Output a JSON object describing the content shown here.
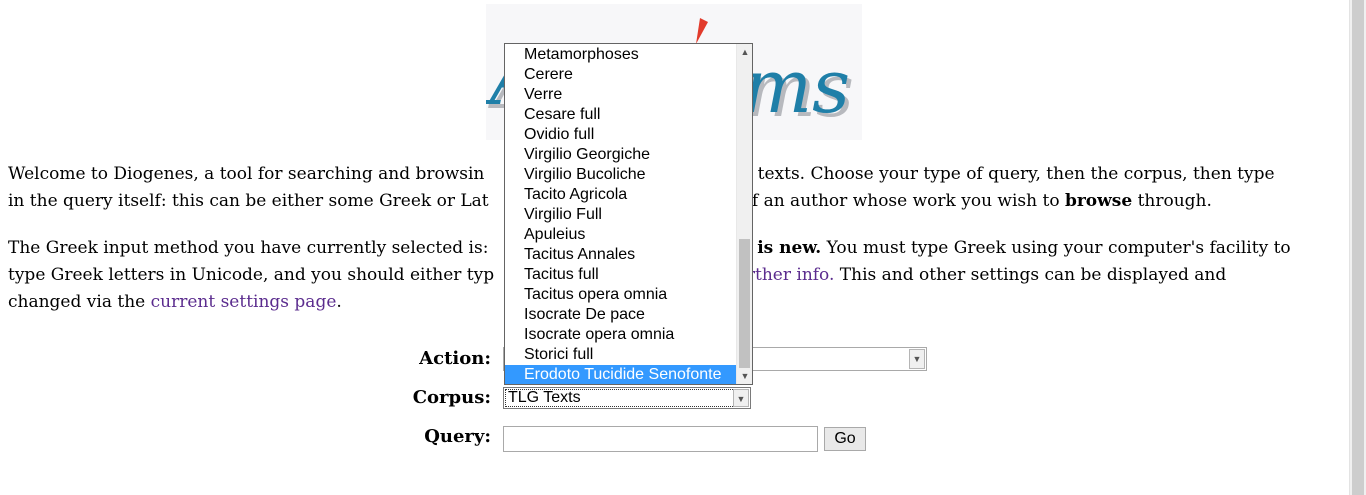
{
  "logo": {
    "alt_text": "Diogenes",
    "colors": {
      "primary": "#1f7fa8",
      "accent": "#e23b2c",
      "shadow": "#6b6f78"
    }
  },
  "intro": {
    "p1": {
      "a": "Welcome to Diogenes, a tool for searching and browsin",
      "b": "ent texts. Choose your type of query, then the corpus, then type",
      "c": "in the query itself: this can be either some Greek or Lat",
      "d": "of an author whose work you wish to ",
      "browse": "browse",
      "e": " through."
    },
    "p2": {
      "a": "The Greek input method you have currently selected is:",
      "bold": "t is new.",
      "b": " You must type Greek using your computer's facility to",
      "c": "type Greek letters in Unicode, and you should either typ",
      "further_info": "Further info.",
      "d": " This and other settings can be displayed and",
      "e": "changed via the ",
      "settings_link": "current settings page",
      "f": "."
    }
  },
  "form": {
    "action_label": "Action:",
    "corpus_label": "Corpus:",
    "query_label": "Query:",
    "corpus_value": "TLG Texts",
    "query_value": "",
    "go_label": "Go"
  },
  "dropdown": {
    "items": [
      "Metamorphoses",
      "Cerere",
      "Verre",
      "Cesare full",
      "Ovidio full",
      "Virgilio Georgiche",
      "Virgilio Bucoliche",
      "Tacito Agricola",
      "Virgilio Full",
      "Apuleius",
      "Tacitus Annales",
      "Tacitus full",
      "Tacitus opera omnia",
      "Isocrate De pace",
      "Isocrate opera omnia",
      "Storici full",
      "Erodoto Tucidide Senofonte"
    ],
    "selected_index": 16,
    "scroll_fraction": 1.0,
    "visible_fraction": 0.42,
    "highlight_color": "#3399ff"
  }
}
